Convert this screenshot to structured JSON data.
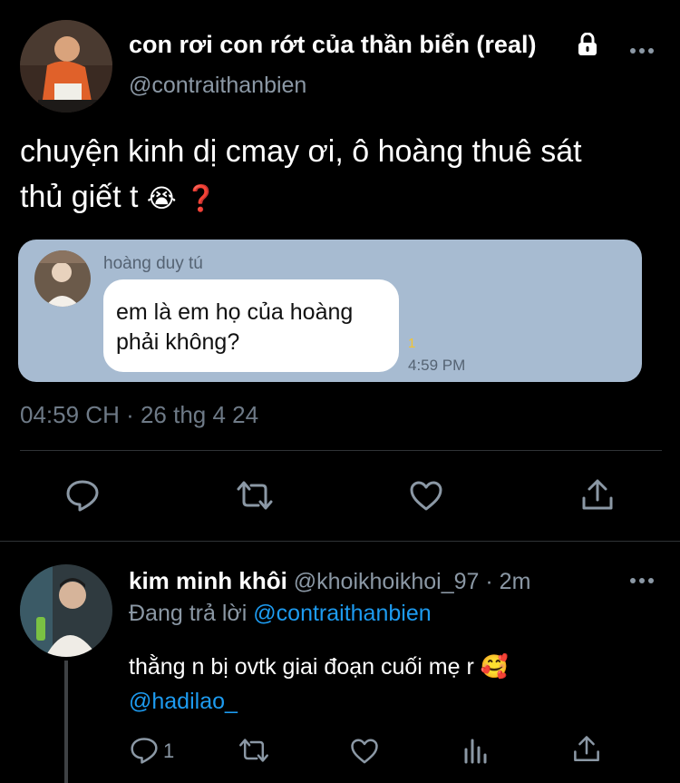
{
  "tweet": {
    "display_name": "con rơi con rớt của thần biển (real)",
    "handle": "@contraithanbien",
    "text_line1": "chuyện kinh dị cmay ơi, ô hoàng thuê sát",
    "text_line2": "thủ giết t",
    "emoji_cry": "😭",
    "emoji_question": "❓",
    "timestamp": "04:59 CH · 26 thg 4 24"
  },
  "embedded_chat": {
    "sender_name": "hoàng duy tú",
    "message_line1": "em là em họ của hoàng",
    "message_line2": "phải không?",
    "read_count": "1",
    "time": "4:59 PM",
    "bubble_color": "#a7bbd1"
  },
  "reply": {
    "display_name": "kim minh khôi",
    "handle": "@khoikhoikhoi_97",
    "time": "· 2m",
    "replying_prefix": "Đang trả lời",
    "replying_to": "@contraithanbien",
    "text": "thằng n bị ovtk giai đoạn cuối mẹ r",
    "emoji": "🥰",
    "mention": "@hadilao_",
    "reply_count": "1"
  },
  "colors": {
    "accent": "#1d9bf0",
    "muted": "#8b98a5",
    "background": "#000000"
  }
}
